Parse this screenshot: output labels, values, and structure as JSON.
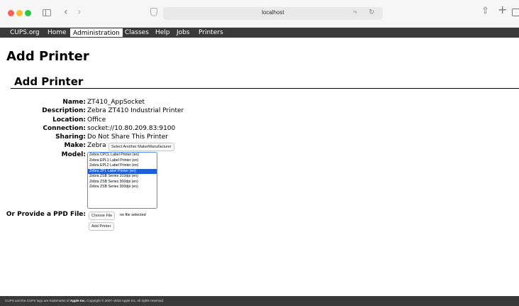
{
  "browser": {
    "url": "localhost"
  },
  "nav": {
    "items": [
      "CUPS.org",
      "Home",
      "Administration",
      "Classes",
      "Help",
      "Jobs",
      "Printers"
    ],
    "active": "Administration"
  },
  "page": {
    "title": "Add Printer",
    "section_title": "Add Printer"
  },
  "printer": {
    "name_label": "Name:",
    "name_value": "ZT410_AppSocket",
    "description_label": "Description:",
    "description_value": "Zebra ZT410 Industrial Printer",
    "location_label": "Location:",
    "location_value": "Office",
    "connection_label": "Connection:",
    "connection_value": "socket://10.80.209.83:9100",
    "sharing_label": "Sharing:",
    "sharing_value": "Do Not Share This Printer",
    "make_label": "Make:",
    "make_value": "Zebra",
    "make_button": "Select Another Make/Manufacturer",
    "model_label": "Model:",
    "models": [
      "Zebra CPCL Label Printer (en)",
      "Zebra EPL1 Label Printer (en)",
      "Zebra EPL2 Label Printer (en)",
      "Zebra ZPL Label Printer (en)",
      "Zebra ZSB Series 203dpi (en)",
      "Zebra ZSB Series 300dpi (en)",
      "Zebra ZSB Series 300dpi (en)"
    ],
    "selected_model": "Zebra ZPL Label Printer (en)",
    "ppd_label": "Or Provide a PPD File:",
    "choose_file_button": "Choose File",
    "file_status": "no file selected",
    "submit_button": "Add Printer"
  },
  "footer": {
    "text_before": "CUPS and the CUPS logo are trademarks of ",
    "brand": "Apple Inc.",
    "text_after": " Copyright © 2007–2019 Apple Inc. All rights reserved."
  },
  "colors": {
    "nav_bg": "#3a3a3a",
    "selection": "#1e5ed6",
    "focus_ring": "#4d8df5"
  }
}
